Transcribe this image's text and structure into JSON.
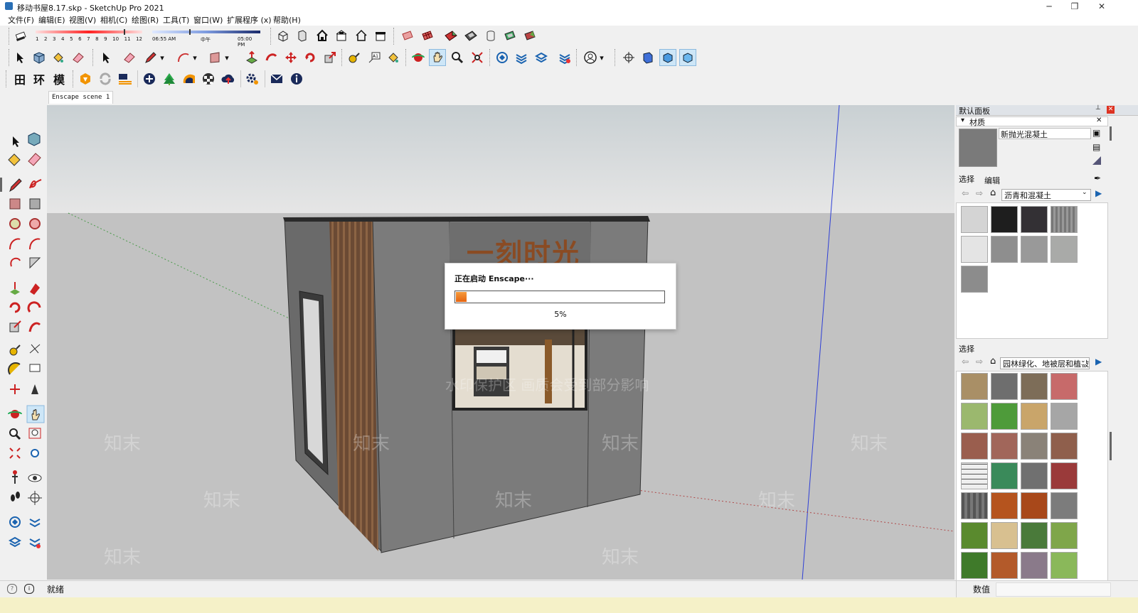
{
  "window": {
    "title": "移动书屋8.17.skp - SketchUp Pro 2021"
  },
  "menu": [
    "文件(F)",
    "编辑(E)",
    "视图(V)",
    "相机(C)",
    "绘图(R)",
    "工具(T)",
    "窗口(W)",
    "扩展程序 (x)",
    "帮助(H)"
  ],
  "shadow": {
    "months": [
      "1",
      "2",
      "3",
      "4",
      "5",
      "6",
      "7",
      "8",
      "9",
      "10",
      "11",
      "12"
    ],
    "time_start": "06:55 AM",
    "time_mid": "中午",
    "time_end": "05:00 PM"
  },
  "toolbar3_labels": {
    "grid": "田",
    "env": "环",
    "model": "模"
  },
  "scene_tab": "Enscape scene 1",
  "dialog": {
    "title": "正在启动 Enscape···",
    "percent_text": "5%",
    "progress": 0.05
  },
  "watermark": {
    "banner": "水印保护区  画质会受到部分影响",
    "tile": "知末"
  },
  "building_sign": "一刻时光",
  "panel": {
    "title": "默认面板",
    "section": "材质",
    "material_name": "新抛光混凝土",
    "tab_select": "选择",
    "tab_edit": "编辑",
    "library1": "沥青和混凝土",
    "section2": "选择",
    "library2": "园林绿化、地被层和植被"
  },
  "status": {
    "ready": "就绪",
    "measurements_label": "数值"
  },
  "colors": {
    "accent_orange": "#e6640f",
    "progress_fill": "#f28c28",
    "sky_top": "#c9d0d3",
    "ground": "#c2c2c2",
    "selected_tool_bg": "#cde6f7"
  },
  "icons": {
    "top_row2": [
      "select-icon",
      "component-icon",
      "paint-bucket-icon",
      "eraser-icon",
      "select-icon",
      "eraser-icon",
      "pencil-icon",
      "arc-icon",
      "rectangle-icon",
      "push-pull-icon",
      "follow-me-icon",
      "move-icon",
      "rotate-icon",
      "scale-icon",
      "tape-measure-icon",
      "text-icon",
      "paint-icon",
      "orbit-icon",
      "pan-icon",
      "zoom-icon",
      "zoom-extents-icon",
      "section-icon",
      "section-display-icon",
      "section-cut-icon",
      "section-fill-icon",
      "user-icon",
      "axes-icon",
      "cube-icon",
      "cube-icon",
      "cube-icon"
    ]
  }
}
